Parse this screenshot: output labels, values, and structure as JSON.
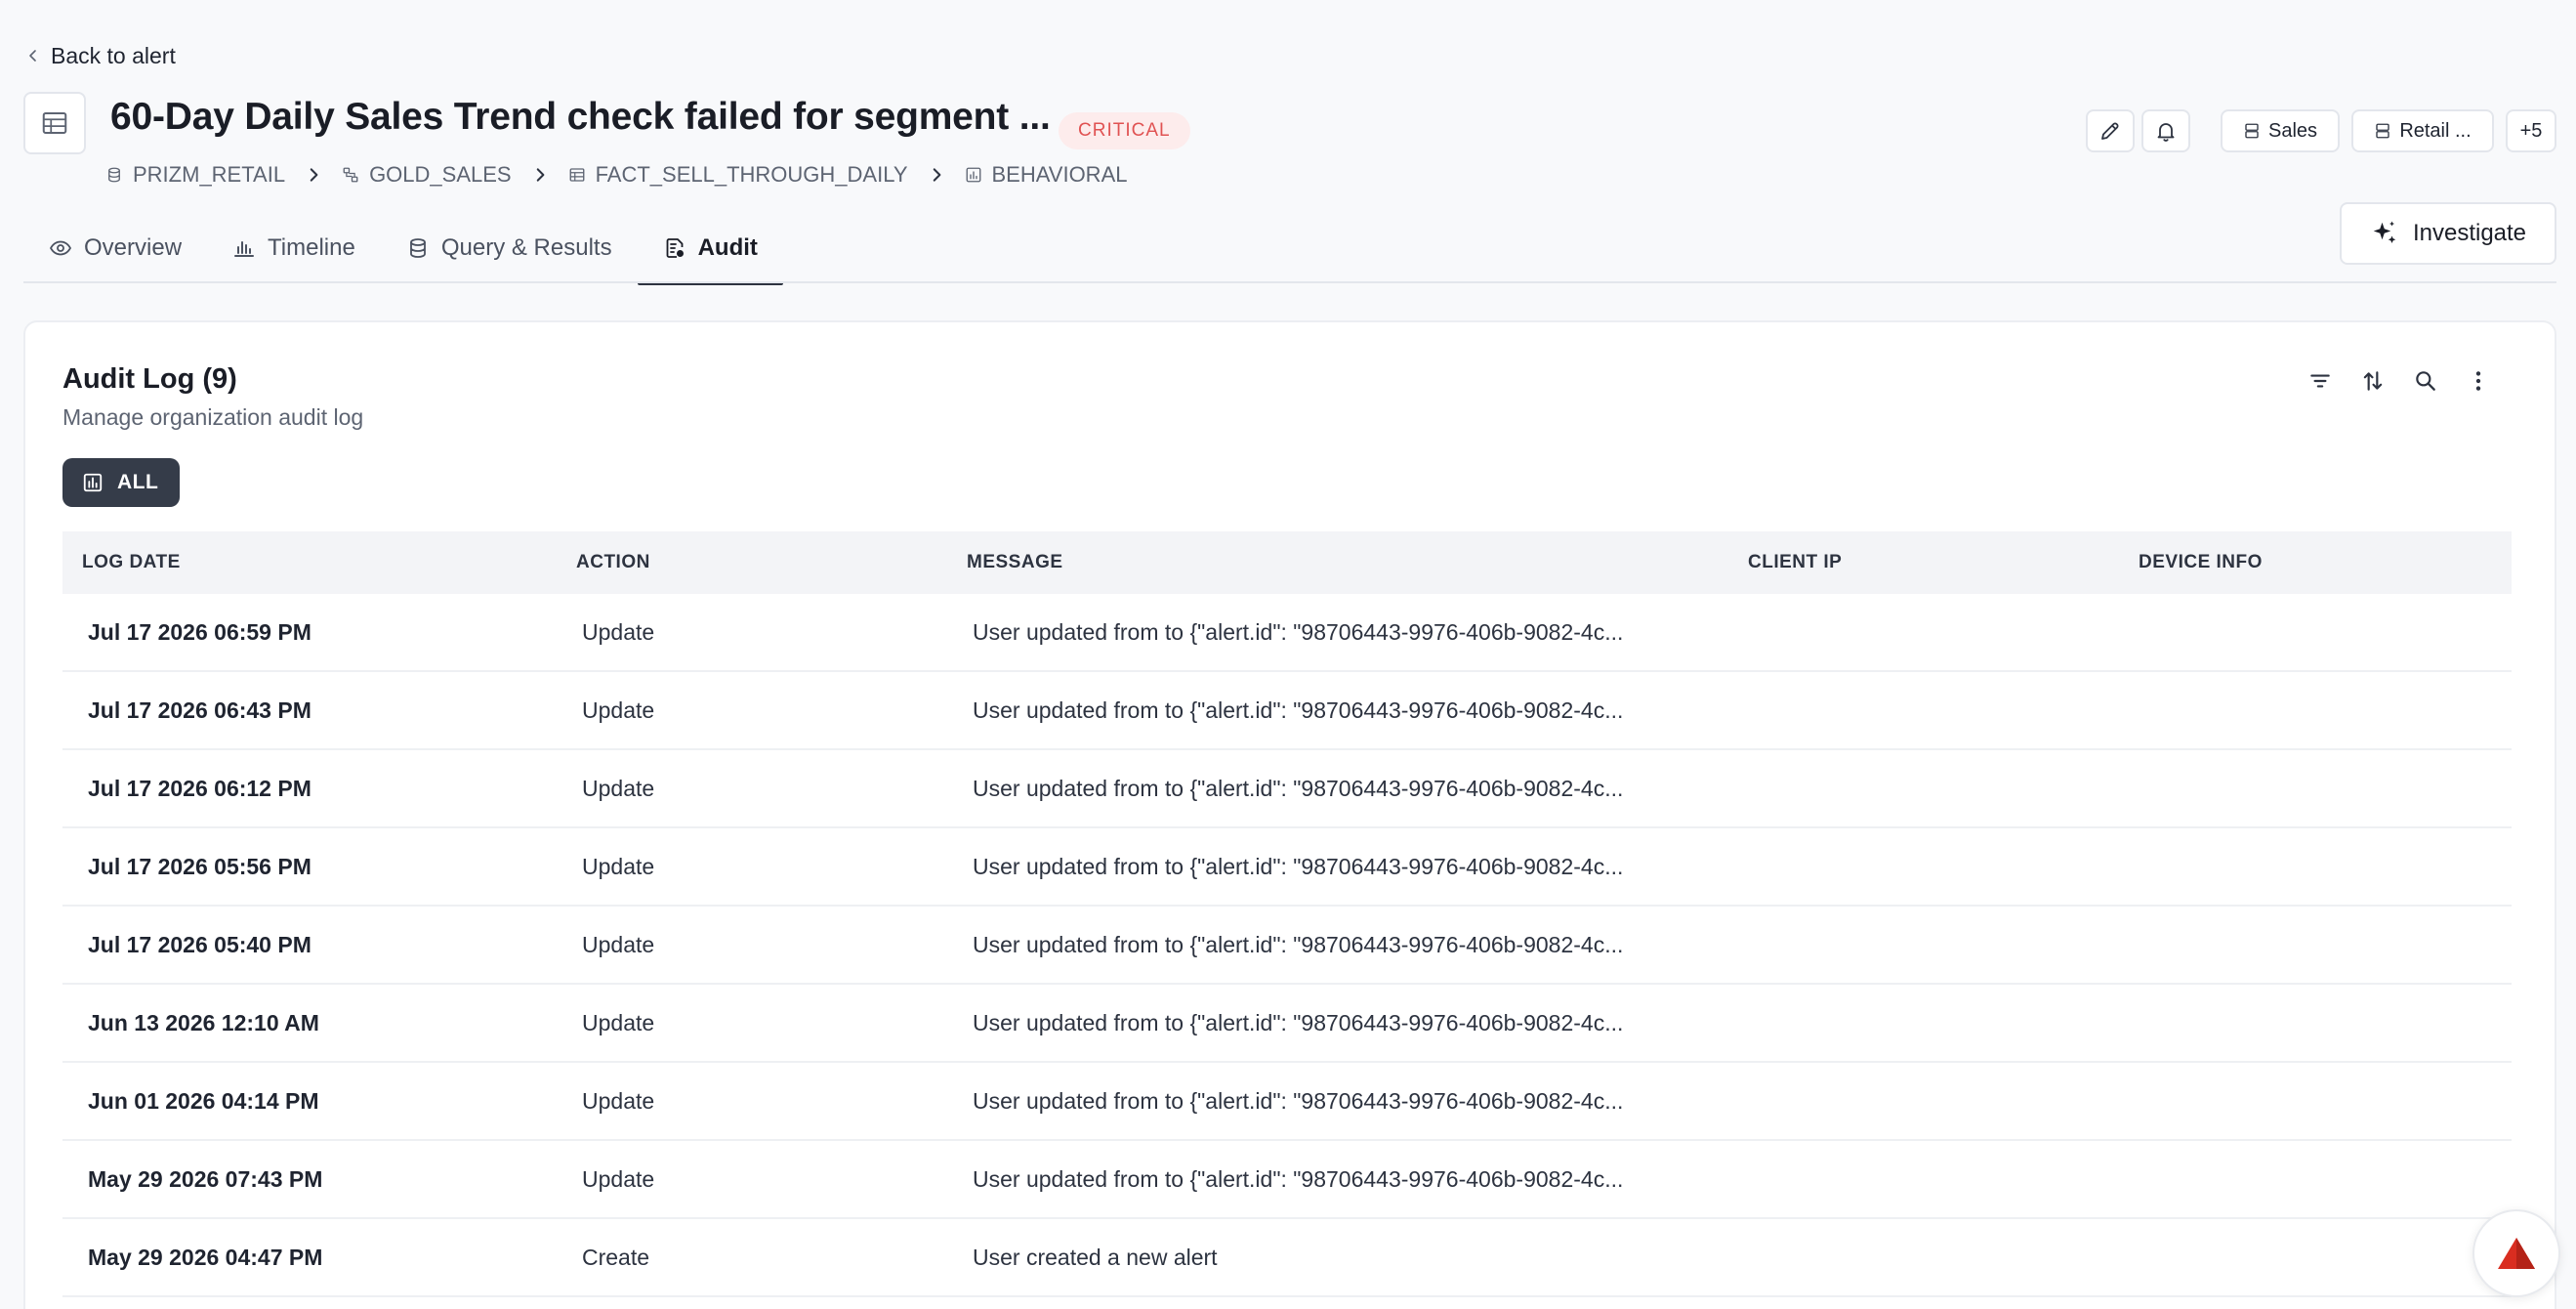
{
  "nav": {
    "back_label": "Back to alert"
  },
  "header": {
    "title": "60-Day Daily Sales Trend check failed for segment ...",
    "severity": "CRITICAL",
    "breadcrumb": [
      "PRIZM_RETAIL",
      "GOLD_SALES",
      "FACT_SELL_THROUGH_DAILY",
      "BEHAVIORAL"
    ],
    "tags": [
      "Sales",
      "Retail ..."
    ],
    "more_tags": "+5"
  },
  "tabs": [
    {
      "label": "Overview",
      "icon": "eye-icon"
    },
    {
      "label": "Timeline",
      "icon": "bar-chart-icon"
    },
    {
      "label": "Query & Results",
      "icon": "database-icon"
    },
    {
      "label": "Audit",
      "icon": "audit-icon",
      "active": true
    }
  ],
  "actions": {
    "investigate_label": "Investigate"
  },
  "audit": {
    "title": "Audit Log (9)",
    "subtitle": "Manage organization audit log",
    "filter_label": "ALL",
    "columns": [
      "LOG DATE",
      "ACTION",
      "MESSAGE",
      "CLIENT IP",
      "DEVICE INFO"
    ],
    "rows": [
      {
        "date": "Jul 17 2026 06:59 PM",
        "action": "Update",
        "message": "User updated from to {\"alert.id\": \"98706443-9976-406b-9082-4c..."
      },
      {
        "date": "Jul 17 2026 06:43 PM",
        "action": "Update",
        "message": "User updated from to {\"alert.id\": \"98706443-9976-406b-9082-4c..."
      },
      {
        "date": "Jul 17 2026 06:12 PM",
        "action": "Update",
        "message": "User updated from to {\"alert.id\": \"98706443-9976-406b-9082-4c..."
      },
      {
        "date": "Jul 17 2026 05:56 PM",
        "action": "Update",
        "message": "User updated from to {\"alert.id\": \"98706443-9976-406b-9082-4c..."
      },
      {
        "date": "Jul 17 2026 05:40 PM",
        "action": "Update",
        "message": "User updated from to {\"alert.id\": \"98706443-9976-406b-9082-4c..."
      },
      {
        "date": "Jun 13 2026 12:10 AM",
        "action": "Update",
        "message": "User updated from to {\"alert.id\": \"98706443-9976-406b-9082-4c..."
      },
      {
        "date": "Jun 01 2026 04:14 PM",
        "action": "Update",
        "message": "User updated from to {\"alert.id\": \"98706443-9976-406b-9082-4c..."
      },
      {
        "date": "May 29 2026 07:43 PM",
        "action": "Update",
        "message": "User updated from to {\"alert.id\": \"98706443-9976-406b-9082-4c..."
      },
      {
        "date": "May 29 2026 04:47 PM",
        "action": "Create",
        "message": "User created a new alert"
      }
    ]
  },
  "colors": {
    "accent_dark": "#353c49",
    "critical_bg": "#fdecec",
    "critical_text": "#e05252",
    "brand_red": "#d92d20"
  }
}
